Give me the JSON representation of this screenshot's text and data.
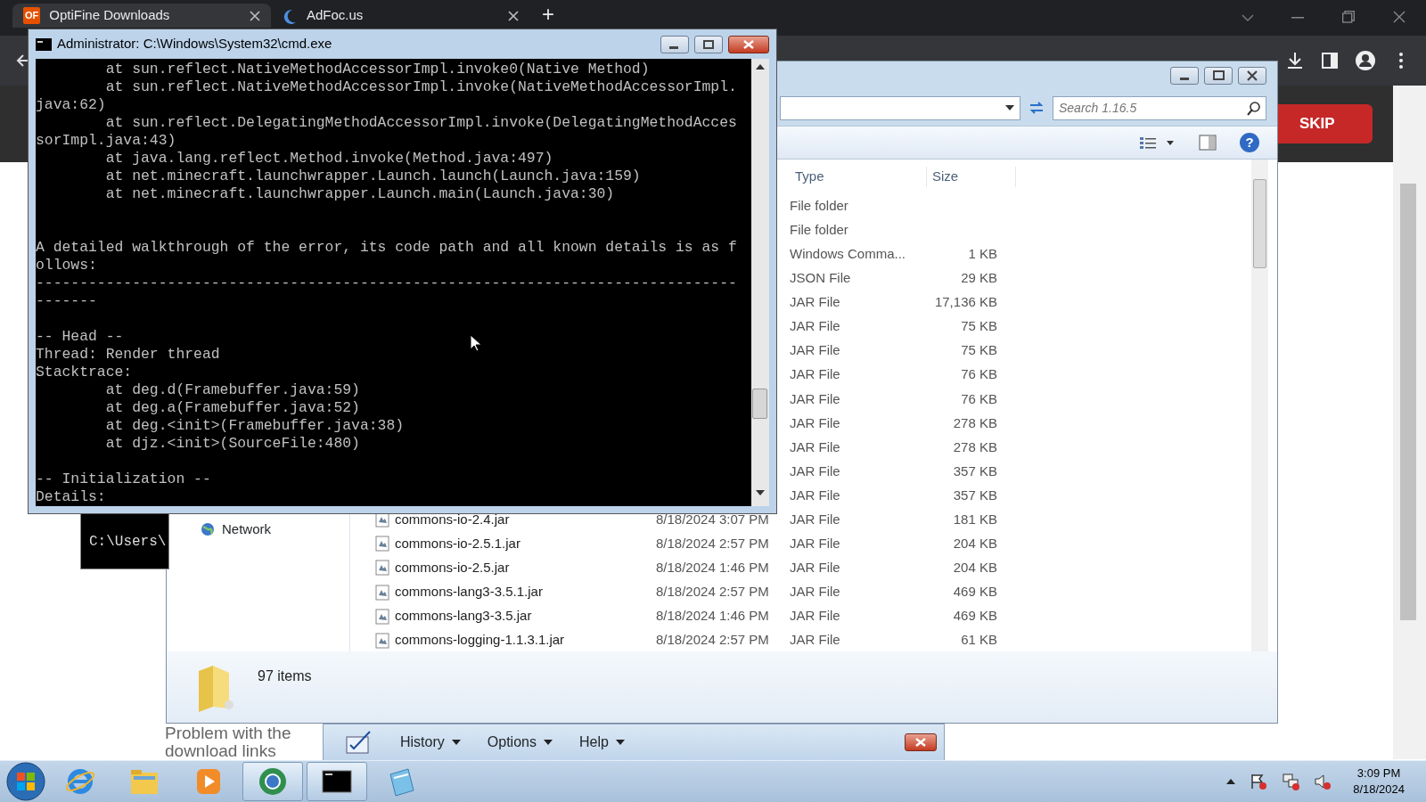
{
  "browser": {
    "tabs": [
      {
        "favicon": "OF",
        "label": "OptiFine Downloads",
        "selected": true
      },
      {
        "label": "AdFoc.us",
        "selected": false
      }
    ],
    "new_tab": "+",
    "page": {
      "skip_button": "SKIP",
      "text_lines": [
        "Problem with the",
        "download links"
      ]
    }
  },
  "cmd_window": {
    "title": "Administrator: C:\\Windows\\System32\\cmd.exe",
    "lines": [
      {
        "kind": "text",
        "text": "        at sun.reflect.NativeMethodAccessorImpl.invoke0(Native Method)"
      },
      {
        "kind": "text",
        "text": "        at sun.reflect.NativeMethodAccessorImpl.invoke(NativeMethodAccessorImpl."
      },
      {
        "kind": "text",
        "text": "java:62)"
      },
      {
        "kind": "text",
        "text": "        at sun.reflect.DelegatingMethodAccessorImpl.invoke(DelegatingMethodAcces"
      },
      {
        "kind": "text",
        "text": "sorImpl.java:43)"
      },
      {
        "kind": "text",
        "text": "        at java.lang.reflect.Method.invoke(Method.java:497)"
      },
      {
        "kind": "text",
        "text": "        at net.minecraft.launchwrapper.Launch.launch(Launch.java:159)"
      },
      {
        "kind": "text",
        "text": "        at net.minecraft.launchwrapper.Launch.main(Launch.java:30)"
      },
      {
        "kind": "blank"
      },
      {
        "kind": "blank"
      },
      {
        "kind": "text",
        "text": "A detailed walkthrough of the error, its code path and all known details is as f"
      },
      {
        "kind": "text",
        "text": "ollows:"
      },
      {
        "kind": "text",
        "text": "--------------------------------------------------------------------------------"
      },
      {
        "kind": "text",
        "text": "-------"
      },
      {
        "kind": "blank"
      },
      {
        "kind": "text",
        "text": "-- Head --"
      },
      {
        "kind": "text",
        "text": "Thread: Render thread"
      },
      {
        "kind": "text",
        "text": "Stacktrace:"
      },
      {
        "kind": "text",
        "text": "        at deg.d(Framebuffer.java:59)"
      },
      {
        "kind": "text",
        "text": "        at deg.a(Framebuffer.java:52)"
      },
      {
        "kind": "text",
        "text": "        at deg.<init>(Framebuffer.java:38)"
      },
      {
        "kind": "text",
        "text": "        at djz.<init>(SourceFile:480)"
      },
      {
        "kind": "blank"
      },
      {
        "kind": "text",
        "text": "-- Initialization --"
      },
      {
        "kind": "text",
        "text": "Details:"
      }
    ]
  },
  "background_console": {
    "text": "C:\\Users\\"
  },
  "explorer": {
    "search": {
      "placeholder": "Search 1.16.5"
    },
    "help": "?",
    "nav_items": [
      {
        "label": "Network"
      }
    ],
    "columns": [
      "Type",
      "Size"
    ],
    "rows": [
      {
        "type": "File folder"
      },
      {
        "type": "File folder"
      },
      {
        "type": "Windows Comma...",
        "size": "1 KB"
      },
      {
        "type": "JSON File",
        "size": "29 KB"
      },
      {
        "type": "JAR File",
        "size": "17,136 KB"
      },
      {
        "type": "JAR File",
        "size": "75 KB"
      },
      {
        "type": "JAR File",
        "size": "75 KB"
      },
      {
        "type": "JAR File",
        "size": "76 KB"
      },
      {
        "type": "JAR File",
        "size": "76 KB"
      },
      {
        "type": "JAR File",
        "size": "278 KB"
      },
      {
        "type": "JAR File",
        "size": "278 KB"
      },
      {
        "type": "JAR File",
        "size": "357 KB"
      },
      {
        "type": "JAR File",
        "size": "357 KB"
      },
      {
        "name": "commons-io-2.4.jar",
        "date": "8/18/2024 3:07 PM",
        "type": "JAR File",
        "size": "181 KB"
      },
      {
        "name": "commons-io-2.5.1.jar",
        "date": "8/18/2024 2:57 PM",
        "type": "JAR File",
        "size": "204 KB"
      },
      {
        "name": "commons-io-2.5.jar",
        "date": "8/18/2024 1:46 PM",
        "type": "JAR File",
        "size": "204 KB"
      },
      {
        "name": "commons-lang3-3.5.1.jar",
        "date": "8/18/2024 2:57 PM",
        "type": "JAR File",
        "size": "469 KB"
      },
      {
        "name": "commons-lang3-3.5.jar",
        "date": "8/18/2024 1:46 PM",
        "type": "JAR File",
        "size": "469 KB"
      },
      {
        "name": "commons-logging-1.1.3.1.jar",
        "date": "8/18/2024 2:57 PM",
        "type": "JAR File",
        "size": "61 KB"
      }
    ],
    "status": "97 items"
  },
  "app_window": {
    "menus": [
      "History",
      "Options",
      "Help"
    ]
  },
  "taskbar": {
    "apps": [
      {
        "kind": "ie",
        "active": false
      },
      {
        "kind": "folder",
        "active": false
      },
      {
        "kind": "media",
        "active": false
      },
      {
        "kind": "browser",
        "active": true
      },
      {
        "kind": "console",
        "active": true
      },
      {
        "kind": "notepad",
        "active": false
      }
    ],
    "time": "3:09 PM",
    "date": "8/18/2024"
  }
}
